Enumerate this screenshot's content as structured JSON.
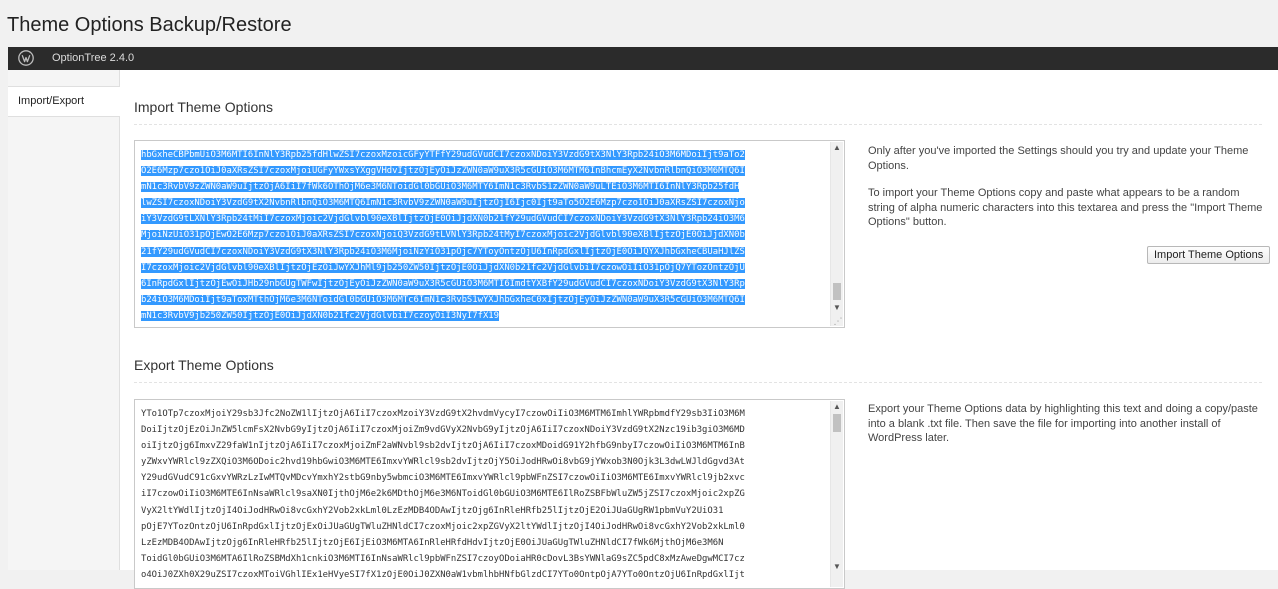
{
  "page": {
    "title": "Theme Options Backup/Restore"
  },
  "header": {
    "logo_icon": "wordpress-logo-icon",
    "version": "OptionTree 2.4.0"
  },
  "tabs": [
    {
      "label": "Import/Export",
      "active": true
    }
  ],
  "import_section": {
    "title": "Import Theme Options",
    "textarea_lines": [
      "hbGxheCBPbmUiO3M6MTI6InNlY3Rpb25fdHlwZSI7czoxMzoicGFyYTFfY29udGVudCI7czoxNDoiY3VzdG9tX3NlY3Rpb24iO3M6MDoiIjt9aTo2",
      "O2E6Mzp7czo1OiJ0aXRsZSI7czoxMjoiUGFyYWxsYXggVHdvIjtzOjEyOiJzZWN0aW9uX3R5cGUiO3M6MTM6InBhcmEyX2NvbnRlbnQiO3M6MTQ6I",
      "mN1c3RvbV9zZWN0aW9uIjtzOjA6IiI7fWk6OThOjM6e3M6NToidGl0bGUiO3M6MTY6ImN1c3RvbS1zZWN0aW9uLTEiO3M6MTI6InNlY3Rpb25fdH",
      "lwZSI7czoxNDoiY3VzdG9tX2NvbnRlbnQiO3M6MTQ6ImN1c3RvbV9zZWN0aW9uIjtzOjI6Ijc0Ijt9aTo5O2E6Mzp7czo1OiJ0aXRsZSI7czoxNjo",
      "iY3VzdG9tLXNlY3Rpb24tMiI7czoxMjoic2VjdGlvbl90eXBlIjtzOjE0OiJjdXN0b21fY29udGVudCI7czoxNDoiY3VzdG9tX3NlY3Rpb24iO3M6",
      "MjoiNzUiO31pOjEwO2E6Mzp7czo1OiJ0aXRsZSI7czoxNjoiQ3VzdG9tLVNlY3Rpb24tMyI7czoxMjoic2VjdGlvbl90eXBlIjtzOjE0OiJjdXN0b",
      "21fY29udGVudCI7czoxNDoiY3VzdG9tX3NlY3Rpb24iO3M6MjoiNzYiO31pOjc7YToyOntzOjU6InRpdGxlIjtzOjE0OiJQYXJhbGxheCBUaHJlZS",
      "I7czoxMjoic2VjdGlvbl90eXBlIjtzOjEzOiJwYXJhMl9jb250ZW50IjtzOjE0OiJjdXN0b21fc2VjdGlvbiI7czowOiIiO31pOjQ7YTozOntzOjU",
      "6InRpdGxlIjtzOjEwOiJHb29nbGUgTWFwIjtzOjEyOiJzZWN0aW9uX3R5cGUiO3M6MTI6ImdtYXBfY29udGVudCI7czoxNDoiY3VzdG9tX3NlY3Rp",
      "b24iO3M6MDoiIjt9aToxMTthOjM6e3M6NToidGl0bGUiO3M6MTc6ImN1c3RvbS1wYXJhbGxheC0xIjtzOjEyOiJzZWN0aW9uX3R5cGUiO3M6MTQ6I",
      "mN1c3RvbV9jb250ZW50IjtzOjE0OiJjdXN0b21fc2VjdGlvbiI7czoyOiI3NyI7fX19"
    ],
    "description": [
      "Only after you've imported the Settings should you try and update your Theme Options.",
      "To import your Theme Options copy and paste what appears to be a random string of alpha numeric characters into this textarea and press the \"Import Theme Options\" button."
    ],
    "button_label": "Import Theme Options"
  },
  "export_section": {
    "title": "Export Theme Options",
    "textarea_lines": [
      "YTo1OTp7czoxMjoiY29sb3Jfc2NoZW1lIjtzOjA6IiI7czoxMzoiY3VzdG9tX2hvdmVycyI7czowOiIiO3M6MTM6ImhlYWRpbmdfY29sb3IiO3M6M",
      "DoiIjtzOjEzOiJnZW5lcmFsX2NvbG9yIjtzOjA6IiI7czoxMjoiZm9vdGVyX2NvbG9yIjtzOjA6IiI7czoxNDoiY3VzdG9tX2Nzc19ib3giO3M6MD",
      "oiIjtzOjg6ImxvZ29faW1nIjtzOjA6IiI7czoxMjoiZmF2aWNvbl9sb2dvIjtzOjA6IiI7czoxMDoidG91Y2hfbG9nbyI7czowOiIiO3M6MTM6InB",
      "yZWxvYWRlcl9zZXQiO3M6ODoic2hvd19hbGwiO3M6MTE6ImxvYWRlcl9sb2dvIjtzOjY5OiJodHRwOi8vbG9jYWxob3N0Ojk3L3dwLWJldGgvd3At",
      "Y29udGVudC91cGxvYWRzLzIwMTQvMDcvYmxhY2stbG9nby5wbmciO3M6MTE6ImxvYWRlcl9pbWFnZSI7czowOiIiO3M6MTE6ImxvYWRlcl9jb2xvc",
      "iI7czowOiIiO3M6MTE6InNsaWRlcl9saXN0IjthOjM6e2k6MDthOjM6e3M6NToidGl0bGUiO3M6MTE6IlRoZSBFbWluZW5jZSI7czoxMjoic2xpZG",
      "VyX2ltYWdlIjtzOjI4OiJodHRwOi8vcGxhY2Vob2xkLml0LzEzMDB4ODAwIjtzOjg6InRleHRfb25lIjtzOjE2OiJUaGUgRW1pbmVuY2UiO31",
      "pOjE7YTozOntzOjU6InRpdGxlIjtzOjExOiJUaGUgTWluZHNldCI7czoxMjoic2xpZGVyX2ltYWdlIjtzOjI4OiJodHRwOi8vcGxhY2Vob2xkLml0",
      "LzEzMDB4ODAwIjtzOjg6InRleHRfb25lIjtzOjE6IjEiO3M6MTA6InRleHRfdHdvIjtzOjE0OiJUaGUgTWluZHNldCI7fWk6MjthOjM6e3M6N",
      "ToidGl0bGUiO3M6MTA6IlRoZSBMdXh1cnkiO3M6MTI6InNsaWRlcl9pbWFnZSI7czoyODoiaHR0cDovL3BsYWNlaG9sZC5pdC8xMzAweDgwMCI7cz",
      "o4OiJ0ZXh0X29uZSI7czoxMToiVGhlIEx1eHVyeSI7fX1zOjE0OiJ0ZXN0aW1vbmlhbHNfbGlzdCI7YTo0OntpOjA7YTo0OntzOjU6InRpdGxlIjt"
    ],
    "description": "Export your Theme Options data by highlighting this text and doing a copy/paste into a blank .txt file. Then save the file for importing into another install of WordPress later."
  }
}
